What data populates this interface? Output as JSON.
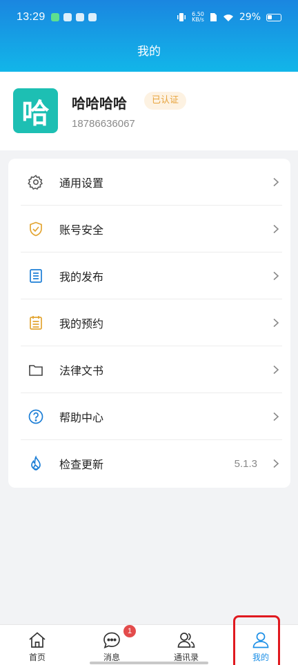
{
  "status_bar": {
    "time": "13:29",
    "speed_value": "6.50",
    "speed_unit": "KB/s",
    "battery": "29%"
  },
  "header": {
    "title": "我的"
  },
  "profile": {
    "avatar_char": "哈",
    "name": "哈哈哈哈",
    "badge": "已认证",
    "phone": "18786636067"
  },
  "menu": [
    {
      "label": "通用设置",
      "icon": "gear-icon",
      "value": ""
    },
    {
      "label": "账号安全",
      "icon": "shield-icon",
      "value": ""
    },
    {
      "label": "我的发布",
      "icon": "document-icon",
      "value": ""
    },
    {
      "label": "我的预约",
      "icon": "calendar-icon",
      "value": ""
    },
    {
      "label": "法律文书",
      "icon": "folder-icon",
      "value": ""
    },
    {
      "label": "帮助中心",
      "icon": "help-icon",
      "value": ""
    },
    {
      "label": "检查更新",
      "icon": "flame-icon",
      "value": "5.1.3"
    }
  ],
  "bottom_nav": [
    {
      "label": "首页",
      "icon": "home-icon"
    },
    {
      "label": "消息",
      "icon": "chat-icon",
      "badge": "1"
    },
    {
      "label": "通讯录",
      "icon": "contacts-icon"
    },
    {
      "label": "我的",
      "icon": "user-icon",
      "active": true
    }
  ],
  "colors": {
    "header_start": "#1a86e0",
    "header_end": "#12b6e9",
    "avatar_bg": "#1dbfb3",
    "badge_text": "#e7a33c",
    "active_nav": "#1a8ee6",
    "notify_badge": "#e34b4b"
  }
}
